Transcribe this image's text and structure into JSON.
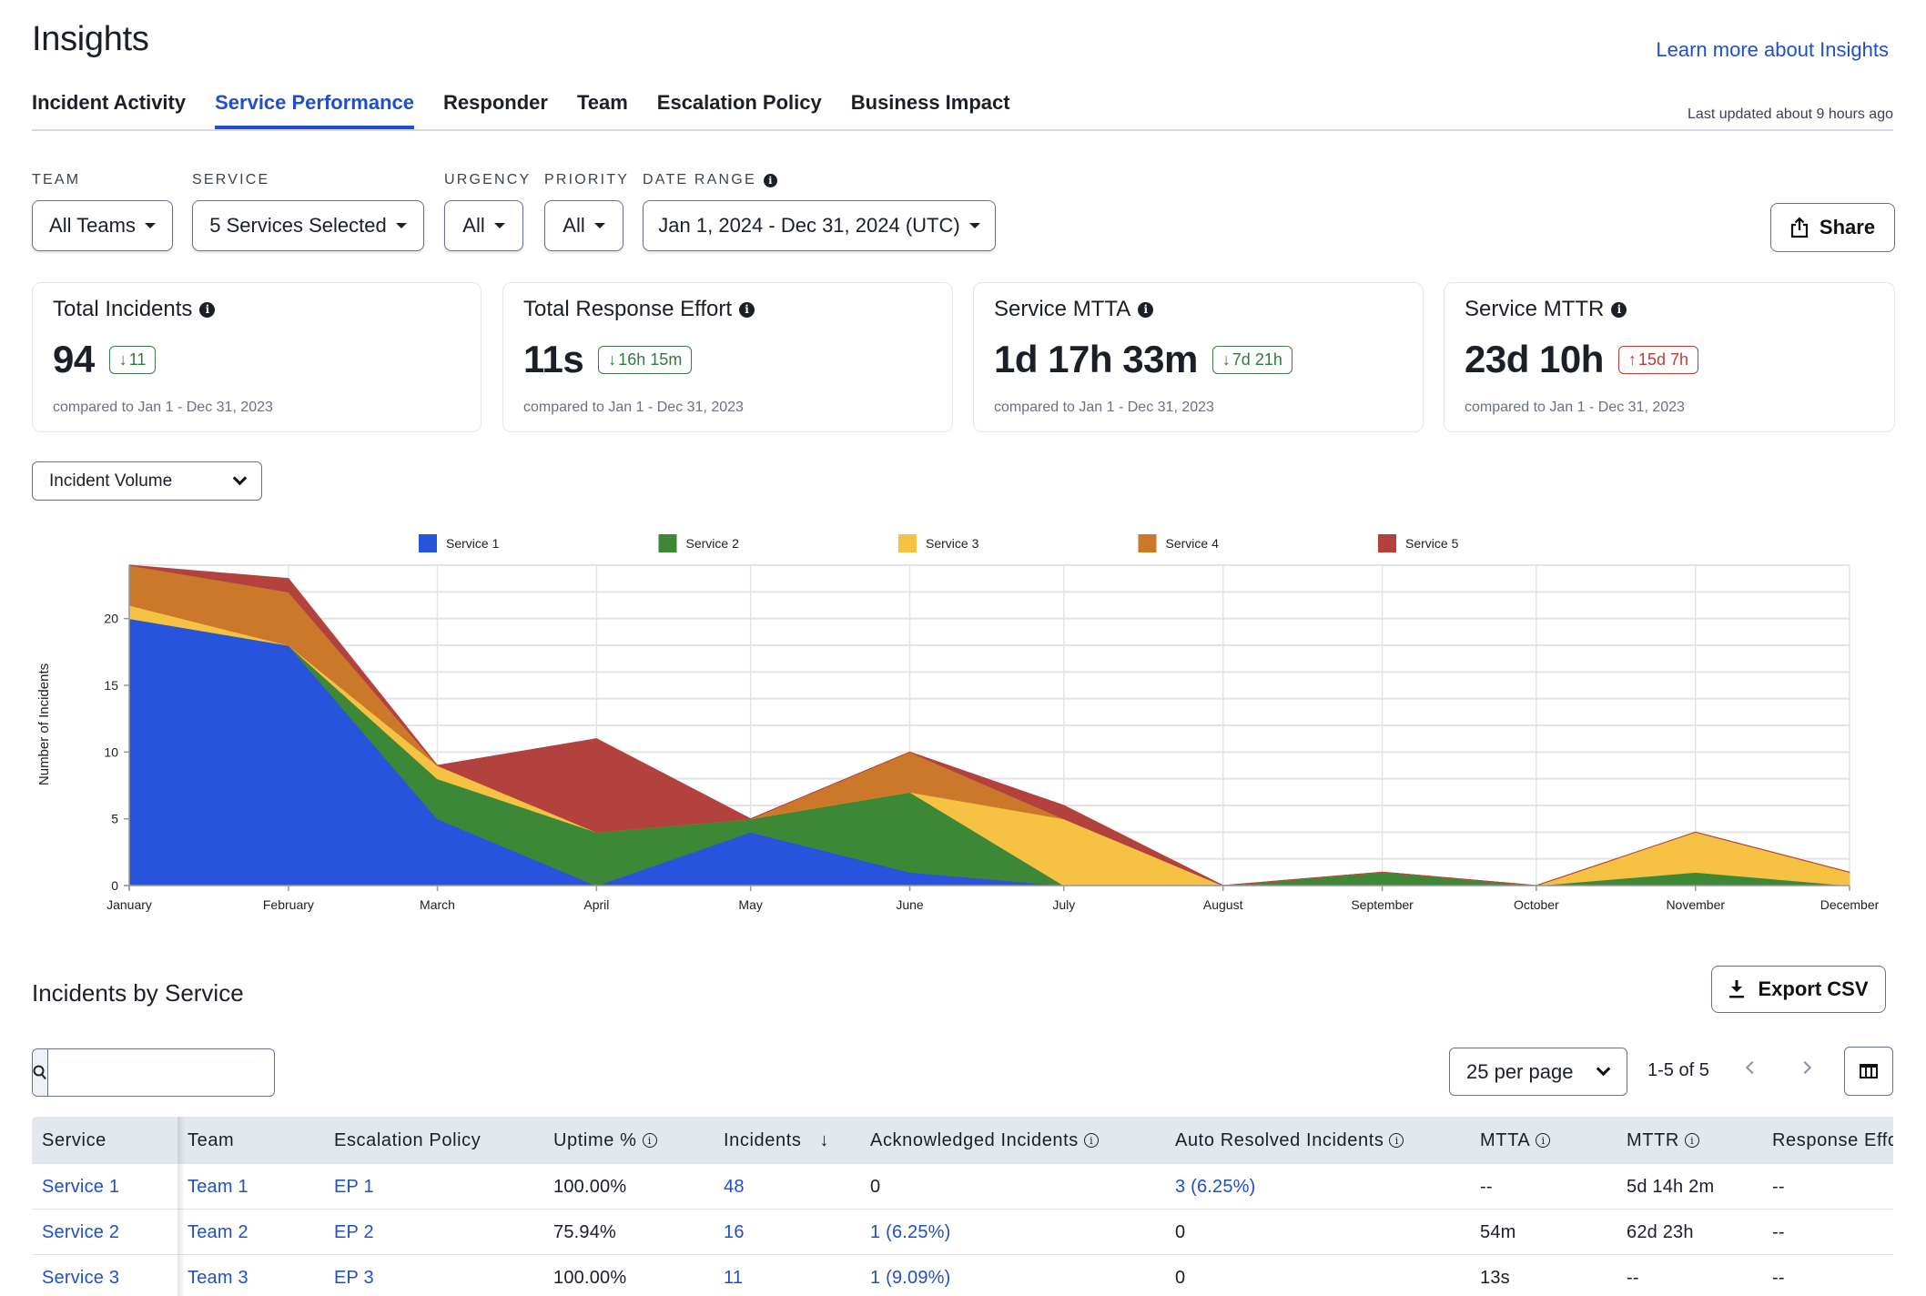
{
  "header": {
    "title": "Insights",
    "learn_more": "Learn more about Insights",
    "last_updated": "Last updated about 9 hours ago"
  },
  "tabs": [
    {
      "label": "Incident Activity",
      "active": false
    },
    {
      "label": "Service Performance",
      "active": true
    },
    {
      "label": "Responder",
      "active": false
    },
    {
      "label": "Team",
      "active": false
    },
    {
      "label": "Escalation Policy",
      "active": false
    },
    {
      "label": "Business Impact",
      "active": false
    }
  ],
  "filters": {
    "team": {
      "label": "TEAM",
      "value": "All Teams"
    },
    "service": {
      "label": "SERVICE",
      "value": "5 Services Selected"
    },
    "urgency": {
      "label": "URGENCY",
      "value": "All"
    },
    "priority": {
      "label": "PRIORITY",
      "value": "All"
    },
    "date_range": {
      "label": "DATE RANGE",
      "value": "Jan 1, 2024 - Dec 31, 2024 (UTC)"
    },
    "share_label": "Share"
  },
  "cards": [
    {
      "title": "Total Incidents",
      "value": "94",
      "delta": "11",
      "direction": "down",
      "compare": "compared to Jan 1 - Dec 31, 2023"
    },
    {
      "title": "Total Response Effort",
      "value": "11s",
      "delta": "16h 15m",
      "direction": "down",
      "compare": "compared to Jan 1 - Dec 31, 2023"
    },
    {
      "title": "Service MTTA",
      "value": "1d 17h 33m",
      "delta": "7d 21h",
      "direction": "down",
      "compare": "compared to Jan 1 - Dec 31, 2023"
    },
    {
      "title": "Service MTTR",
      "value": "23d 10h",
      "delta": "15d 7h",
      "direction": "up",
      "compare": "compared to Jan 1 - Dec 31, 2023"
    }
  ],
  "colors": {
    "accent": "#1f4fc9",
    "positive": "#2e7d3b",
    "negative": "#c63a32"
  },
  "metric_select": {
    "value": "Incident Volume"
  },
  "chart_data": {
    "type": "area",
    "stacked": true,
    "title": "",
    "xlabel": "",
    "ylabel": "Number of Incidents",
    "categories": [
      "January",
      "February",
      "March",
      "April",
      "May",
      "June",
      "July",
      "August",
      "September",
      "October",
      "November",
      "December"
    ],
    "ylim": [
      0,
      24
    ],
    "yticks": [
      0,
      5,
      10,
      15,
      20
    ],
    "grid": true,
    "legend_position": "top",
    "series": [
      {
        "name": "Service 1",
        "color": "#2853dd",
        "values": [
          20,
          18,
          5,
          0,
          4,
          1,
          0,
          0,
          0,
          0,
          0,
          0
        ]
      },
      {
        "name": "Service 2",
        "color": "#3d8836",
        "values": [
          0,
          0,
          3,
          4,
          1,
          6,
          0,
          0,
          1,
          0,
          1,
          0
        ]
      },
      {
        "name": "Service 3",
        "color": "#f5c244",
        "values": [
          1,
          0,
          1,
          0,
          0,
          0,
          5,
          0,
          0,
          0,
          3,
          1
        ]
      },
      {
        "name": "Service 4",
        "color": "#cc782b",
        "values": [
          3,
          4,
          0,
          0,
          0,
          3,
          0,
          0,
          0,
          0,
          0,
          0
        ]
      },
      {
        "name": "Service 5",
        "color": "#b3413e",
        "values": [
          0,
          1,
          0,
          7,
          0,
          0,
          1,
          0,
          0,
          0,
          0,
          0
        ]
      }
    ]
  },
  "table_section": {
    "title": "Incidents by Service",
    "export_label": "Export CSV",
    "search_placeholder": "",
    "per_page": "25 per page",
    "page_range": "1-5 of 5",
    "columns": [
      {
        "label": "Service",
        "info": false,
        "sort": false
      },
      {
        "label": "Team",
        "info": false,
        "sort": false
      },
      {
        "label": "Escalation Policy",
        "info": false,
        "sort": false
      },
      {
        "label": "Uptime %",
        "info": true,
        "sort": false
      },
      {
        "label": "Incidents",
        "info": false,
        "sort": true
      },
      {
        "label": "Acknowledged Incidents",
        "info": true,
        "sort": false
      },
      {
        "label": "Auto Resolved Incidents",
        "info": true,
        "sort": false
      },
      {
        "label": "MTTA",
        "info": true,
        "sort": false
      },
      {
        "label": "MTTR",
        "info": true,
        "sort": false
      },
      {
        "label": "Response Effo",
        "info": false,
        "sort": false
      }
    ],
    "rows": [
      {
        "service": "Service 1",
        "team": "Team 1",
        "ep": "EP 1",
        "uptime": "100.00%",
        "incidents": "48",
        "ack": "0",
        "auto": "3 (6.25%)",
        "mtta": "--",
        "mttr": "5d 14h 2m",
        "effort": "--"
      },
      {
        "service": "Service 2",
        "team": "Team 2",
        "ep": "EP 2",
        "uptime": "75.94%",
        "incidents": "16",
        "ack": "1 (6.25%)",
        "auto": "0",
        "mtta": "54m",
        "mttr": "62d 23h",
        "effort": "--"
      },
      {
        "service": "Service 3",
        "team": "Team 3",
        "ep": "EP 3",
        "uptime": "100.00%",
        "incidents": "11",
        "ack": "1 (9.09%)",
        "auto": "0",
        "mtta": "13s",
        "mttr": "--",
        "effort": "--"
      }
    ]
  }
}
